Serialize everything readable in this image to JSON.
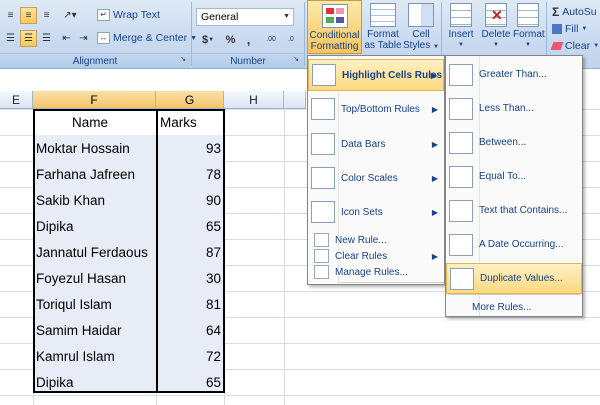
{
  "ribbon": {
    "wrap_text": "Wrap Text",
    "merge_center": "Merge & Center",
    "number_format": "General",
    "currency_sym": "$",
    "percent_sym": "%",
    "comma_sym": ",",
    "dec_inc": ".00",
    "dec_dec": ".0",
    "group_alignment": "Alignment",
    "group_number": "Number",
    "conditional_formatting_l1": "Conditional",
    "conditional_formatting_l2": "Formatting",
    "format_as_table_l1": "Format",
    "format_as_table_l2": "as Table",
    "cell_styles_l1": "Cell",
    "cell_styles_l2": "Styles",
    "insert": "Insert",
    "delete": "Delete",
    "format": "Format",
    "autosum": "AutoSu",
    "fill": "Fill",
    "clear": "Clear"
  },
  "columns": [
    "E",
    "F",
    "G",
    "H"
  ],
  "table": {
    "headers": [
      "Name",
      "Marks"
    ],
    "rows": [
      [
        "Moktar Hossain",
        "93"
      ],
      [
        "Farhana Jafreen",
        "78"
      ],
      [
        "Sakib Khan",
        "90"
      ],
      [
        "Dipika",
        "65"
      ],
      [
        "Jannatul Ferdaous",
        "87"
      ],
      [
        "Foyezul Hasan",
        "30"
      ],
      [
        "Toriqul Islam",
        "81"
      ],
      [
        "Samim Haidar",
        "64"
      ],
      [
        "Kamrul Islam",
        "72"
      ],
      [
        "Dipika",
        "65"
      ]
    ]
  },
  "cf_menu": {
    "items": [
      {
        "label": "Highlight Cells Rules",
        "icon": "highlight-cells-icon"
      },
      {
        "label": "Top/Bottom Rules",
        "icon": "top-bottom-icon"
      },
      {
        "label": "Data Bars",
        "icon": "data-bars-icon"
      },
      {
        "label": "Color Scales",
        "icon": "color-scales-icon"
      },
      {
        "label": "Icon Sets",
        "icon": "icon-sets-icon"
      }
    ],
    "small_items": [
      "New Rule...",
      "Clear Rules",
      "Manage Rules..."
    ]
  },
  "sub_menu": {
    "items": [
      "Greater Than...",
      "Less Than...",
      "Between...",
      "Equal To...",
      "Text that Contains...",
      "A Date Occurring...",
      "Duplicate Values..."
    ],
    "more": "More Rules..."
  },
  "colors": {
    "menu_highlight": "#fbd97e",
    "selection_fill": "#e8ecf7",
    "ribbon_text": "#15428b"
  }
}
